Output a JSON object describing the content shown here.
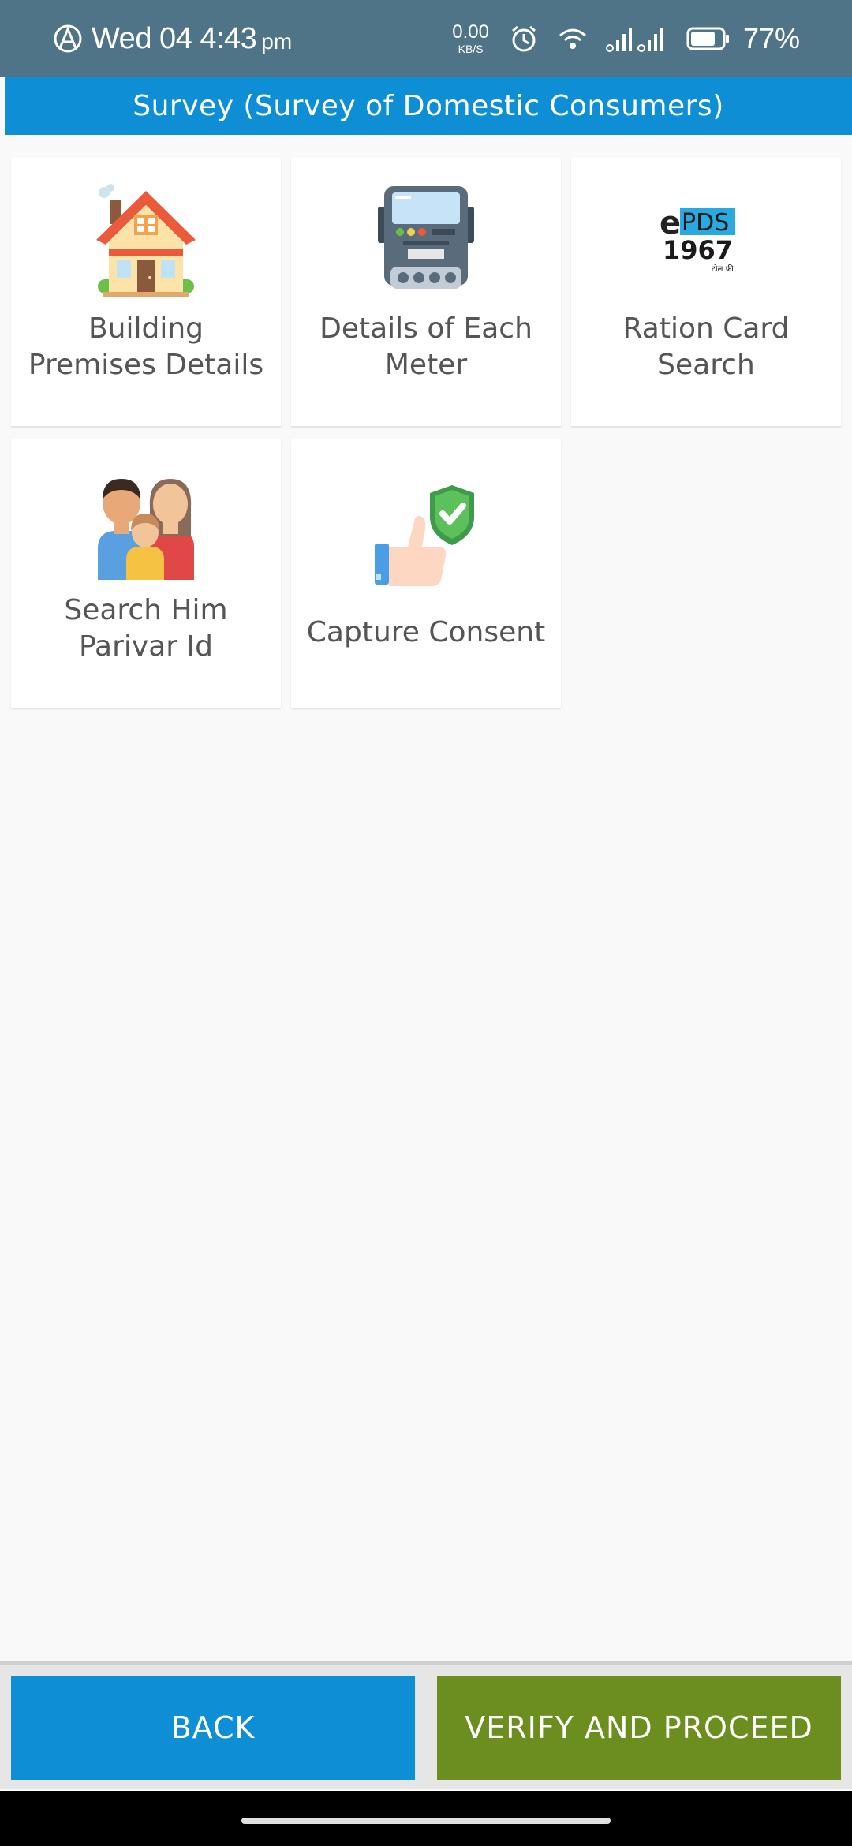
{
  "status_bar": {
    "time": "Wed 04 4:43",
    "ampm": "pm",
    "net_speed_value": "0.00",
    "net_speed_unit": "KB/S",
    "battery_pct": "77%"
  },
  "header": {
    "title": "Survey (Survey of Domestic Consumers)"
  },
  "tiles": [
    {
      "label": "Building\nPremises Details",
      "icon": "house-icon"
    },
    {
      "label": "Details of Each\nMeter",
      "icon": "electric-meter-icon"
    },
    {
      "label": "Ration Card\nSearch",
      "icon": "epds-1967-logo"
    },
    {
      "label": "Search Him\nParivar Id",
      "icon": "family-icon"
    },
    {
      "label": "Capture Consent",
      "icon": "thumbs-up-shield-icon"
    }
  ],
  "epds_logo": {
    "prefix": "e",
    "brand": "PDS",
    "number": "1967",
    "tagline": "टोल फ्री"
  },
  "buttons": {
    "back": "BACK",
    "verify": "VERIFY AND PROCEED"
  },
  "colors": {
    "status_bar": "#4f7387",
    "accent_blue": "#0e8fd5",
    "accent_green": "#6b8e1e",
    "background": "#f9f9f9"
  }
}
